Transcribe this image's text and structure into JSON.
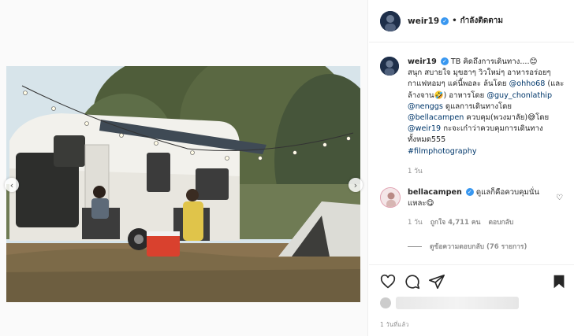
{
  "header": {
    "username": "weir19",
    "separator": "•",
    "follow_state": "กำลังติดตาม"
  },
  "caption": {
    "username": "weir19",
    "line1": "TB คิดถึงการเดินทาง....😊",
    "line2": "สนุก สบายใจ มุขฮาๆ วิวใหม่ๆ อาหารอร่อยๆ กาแฟหอมๆ แค่นี้พอละ ล้นโดย",
    "mention1": "@ohho68",
    "line3": " (และล้างจาน🤣) อาหารโดย",
    "mention2": "@guy_chonlathip",
    "mention3": "@nenggs",
    "line4": " ดูแลการเดินทางโดย ",
    "mention4": "@bellacampen",
    "line5": " ควบคุม(พวงมาลัย)😅โดย ",
    "mention5": "@weir19",
    "line6": " กะจะเก๋าว่าควบคุมการเดินทางทั้งหมด555",
    "hashtag": "#filmphotography",
    "time": "1 วัน"
  },
  "comment": {
    "username": "bellacampen",
    "text": "ดูแลก็คือควบคุมนั่นแหละ😋",
    "time": "1 วัน",
    "likes": "ถูกใจ 4,711 คน",
    "reply": "ตอบกลับ"
  },
  "replies": {
    "label": "ดูข้อความตอบกลับ (76 รายการ)"
  },
  "footer": {
    "posted": "1 วันที่แล้ว"
  },
  "colors": {
    "link": "#00376b",
    "verified": "#3897f0",
    "muted": "#8e8e8e"
  }
}
